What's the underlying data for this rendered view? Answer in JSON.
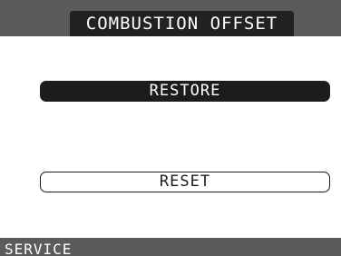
{
  "header": {
    "title": "COMBUSTION OFFSET"
  },
  "main": {
    "restore_label": "RESTORE",
    "reset_label": "RESET"
  },
  "footer": {
    "status": "SERVICE"
  },
  "colors": {
    "frame": "#5b5b5b",
    "title_pill": "#222222",
    "button_selected": "#1c1c1c",
    "background": "#ffffff"
  }
}
